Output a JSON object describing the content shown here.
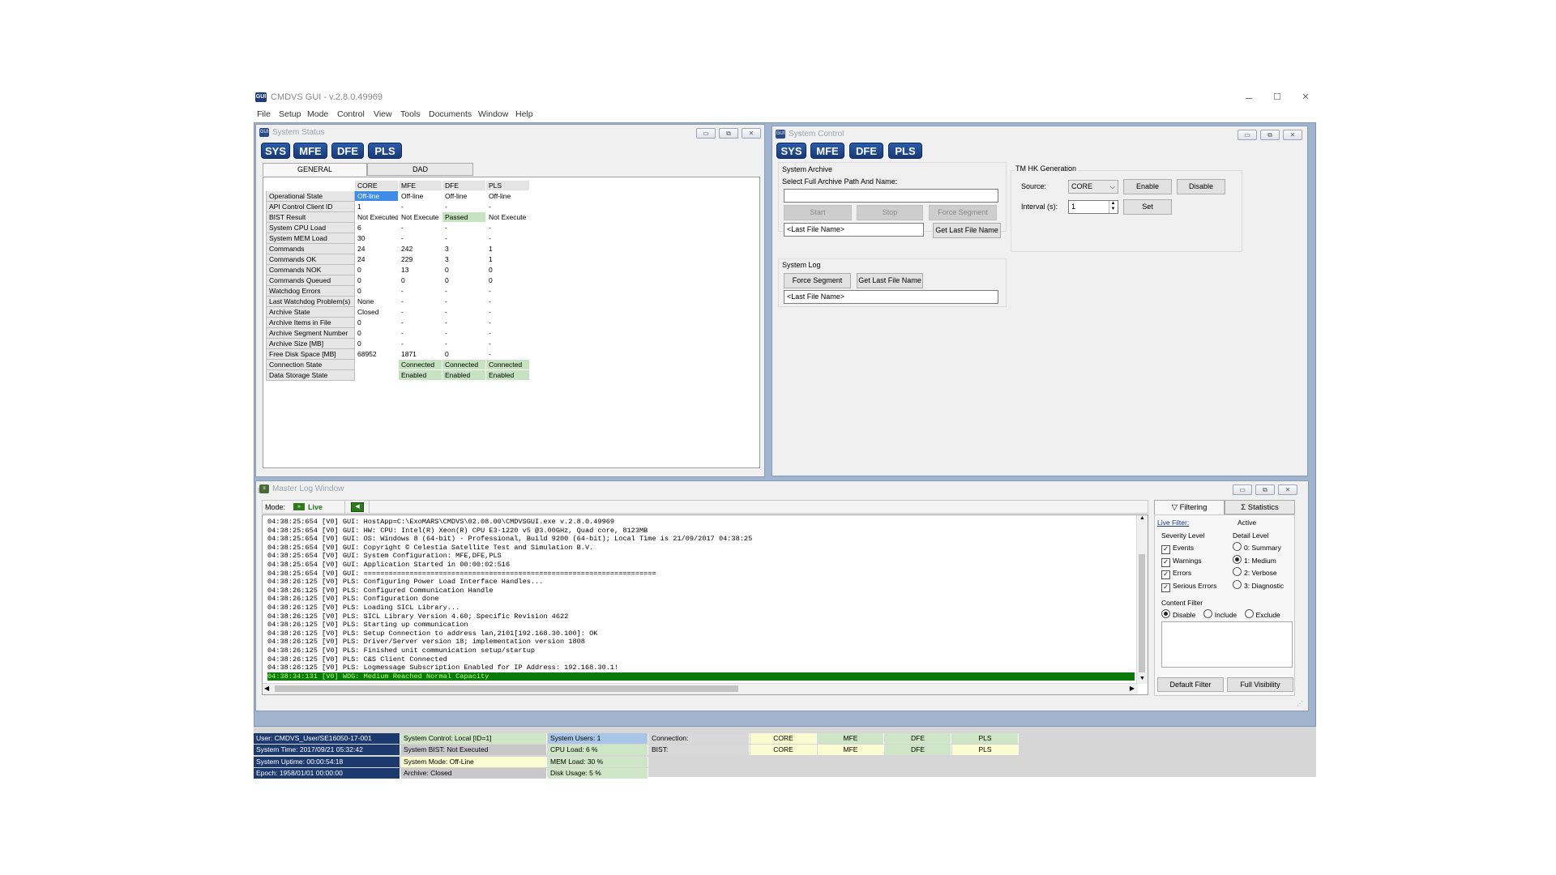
{
  "app": {
    "title": "CMDVS GUI - v.2.8.0.49969",
    "icon": "GUI",
    "menu": [
      "File",
      "Setup",
      "Mode",
      "Control",
      "View",
      "Tools",
      "Documents",
      "Window",
      "Help"
    ],
    "window_controls": {
      "minimize": "–",
      "maximize": "☐",
      "close": "✕"
    }
  },
  "system_status": {
    "title": "System Status",
    "subsystems": [
      "SYS",
      "MFE",
      "DFE",
      "PLS"
    ],
    "tabs": [
      "GENERAL",
      "DAD"
    ],
    "columns": [
      "",
      "CORE",
      "MFE",
      "DFE",
      "PLS"
    ],
    "rows": [
      [
        "Operational State",
        "Off-line",
        "Off-line",
        "Off-line",
        "Off-line"
      ],
      [
        "API Control Client ID",
        "1",
        "-",
        "-",
        "-"
      ],
      [
        "BIST Result",
        "Not Executed",
        "Not Execute",
        "Passed",
        "Not Execute"
      ],
      [
        "System CPU Load",
        "6",
        "-",
        "-",
        "-"
      ],
      [
        "System MEM Load",
        "30",
        "-",
        "-",
        "-"
      ],
      [
        "Commands",
        "24",
        "242",
        "3",
        "1"
      ],
      [
        "Commands OK",
        "24",
        "229",
        "3",
        "1"
      ],
      [
        "Commands NOK",
        "0",
        "13",
        "0",
        "0"
      ],
      [
        "Commands Queued",
        "0",
        "0",
        "0",
        "0"
      ],
      [
        "Watchdog Errors",
        "0",
        "-",
        "-",
        "-"
      ],
      [
        "Last Watchdog Problem(s)",
        "None",
        "-",
        "-",
        "-"
      ],
      [
        "Archive State",
        "Closed",
        "-",
        "-",
        "-"
      ],
      [
        "Archive Items in File",
        "0",
        "-",
        "-",
        "-"
      ],
      [
        "Archive Segment Number",
        "0",
        "-",
        "-",
        "-"
      ],
      [
        "Archive Size [MB]",
        "0",
        "-",
        "-",
        "-"
      ],
      [
        "Free Disk Space [MB]",
        "68952",
        "1871",
        "0",
        "-"
      ],
      [
        "Connection State",
        "",
        "Connected",
        "Connected",
        "Connected"
      ],
      [
        "Data Storage State",
        "",
        "Enabled",
        "Enabled",
        "Enabled"
      ]
    ]
  },
  "system_control": {
    "title": "System Control",
    "subsystems": [
      "SYS",
      "MFE",
      "DFE",
      "PLS"
    ],
    "archive": {
      "group": "System Archive",
      "path_label": "Select Full Archive Path And Name:",
      "path_value": "",
      "start": "Start",
      "stop": "Stop",
      "force_segment": "Force Segment",
      "last_file": "<Last File Name>",
      "get_last": "Get Last File Name"
    },
    "log": {
      "group": "System Log",
      "force_segment": "Force Segment",
      "get_last": "Get Last File Name",
      "last_file": "<Last File Name>"
    },
    "tm": {
      "group": "TM HK Generation",
      "source_label": "Source:",
      "source_value": "CORE",
      "enable": "Enable",
      "disable": "Disable",
      "interval_label": "Interval (s):",
      "interval_value": "1",
      "set": "Set"
    }
  },
  "log_window": {
    "title": "Master Log Window",
    "mode_label": "Mode:",
    "mode_value": "Live",
    "lines": [
      "04:38:25:654 [V0] GUI: HostApp=C:\\ExoMARS\\CMDVS\\02.08.00\\CMDVSGUI.exe v.2.8.0.49969",
      "04:38:25:654 [V0] GUI: HW: CPU: Intel(R) Xeon(R) CPU E3-1220 v5 @3.00GHz, Quad core, 8123MB",
      "04:38:25:654 [V0] GUI: OS: Windows 8 (64-bit) - Professional, Build 9200 (64-bit); Local Time is 21/09/2017 04:38:25",
      "04:38:25:654 [V0] GUI: Copyright © Celestia Satellite Test and Simulation B.V.",
      "04:38:25:654 [V0] GUI: System Configuration: MFE,DFE,PLS",
      "04:38:25:654 [V0] GUI: Application Started in 00:00:02:516",
      "04:38:25:654 [V0] GUI: ======================================================================",
      "04:38:26:125 [V0] PLS: Configuring Power Load Interface Handles...",
      "04:38:26:125 [V0] PLS: Configured Communication Handle",
      "04:38:26:125 [V0] PLS: Configuration done",
      "04:38:26:125 [V0] PLS: Loading SICL Library...",
      "04:38:26:125 [V0] PLS: SICL Library Version 4.60; Specific Revision 4622",
      "04:38:26:125 [V0] PLS: Starting up communication",
      "04:38:26:125 [V0] PLS: Setup Connection to address lan,2101[192.168.30.100]: OK",
      "04:38:26:125 [V0] PLS: Driver/Server version 18; implementation version 1808",
      "04:38:26:125 [V0] PLS: Finished unit communication setup/startup",
      "04:38:26:125 [V0] PLS: C&S Client Connected",
      "04:38:26:125 [V0] PLS: Logmessage Subscription Enabled for IP Address: 192.168.30.1!",
      "04:38:34:131 [V0] WDG: Medium Reached Normal Capacity"
    ],
    "filter": {
      "tab_filtering": "Filtering",
      "tab_statistics": "Statistics",
      "live_filter": "Live Filter:",
      "active": "Active",
      "severity_title": "Severity Level",
      "severity": [
        "Events",
        "Warnings",
        "Errors",
        "Serious Errors"
      ],
      "detail_title": "Detail Level",
      "detail": [
        "0: Summary",
        "1: Medium",
        "2: Verbose",
        "3: Diagnostic"
      ],
      "content_title": "Content Filter",
      "content": [
        "Disable",
        "Include",
        "Exclude"
      ],
      "default_filter": "Default Filter",
      "full_visibility": "Full Visibility"
    }
  },
  "status_bar": {
    "user": "User: CMDVS_User/SE16050-17-001",
    "time": "System Time: 2017/09/21 05:32:42",
    "uptime": "System Uptime: 00:00:54:18",
    "epoch": "Epoch: 1958/01/01 00:00:00",
    "control": "System Control: Local [ID=1]",
    "bist": "System BIST: Not Executed",
    "mode": "System Mode: Off-Line",
    "archive": "Archive: Closed",
    "users": "System Users: 1",
    "cpu": "CPU Load: 6 %",
    "mem": "MEM Load: 30 %",
    "disk": "Disk Usage: 5 %",
    "connection": "Connection:",
    "bist_label": "BIST:",
    "units": [
      "CORE",
      "MFE",
      "DFE",
      "PLS"
    ]
  },
  "colors": {
    "selected_log": "#0a7a0a",
    "navy": "#1d3a6e",
    "mdi_background": "#a0b4d0"
  }
}
